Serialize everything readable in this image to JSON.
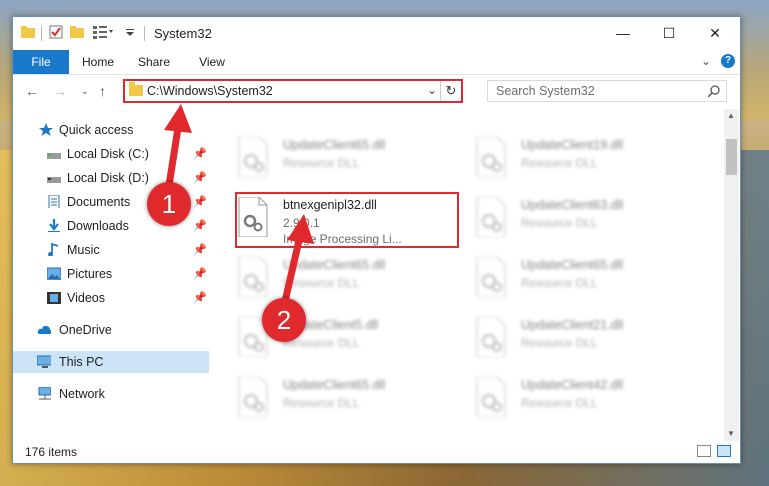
{
  "window": {
    "title": "System32",
    "controls": {
      "minimize": "—",
      "maximize": "☐",
      "close": "✕"
    }
  },
  "ribbon": {
    "tabs": [
      "File",
      "Home",
      "Share",
      "View"
    ],
    "collapse_glyph": "⌄",
    "help_glyph": "?"
  },
  "address": {
    "path": "C:\\Windows\\System32",
    "search_placeholder": "Search System32"
  },
  "nav": {
    "items": [
      {
        "label": "Quick access",
        "icon": "star-icon"
      },
      {
        "label": "Local Disk (C:)",
        "icon": "drive-icon"
      },
      {
        "label": "Local Disk (D:)",
        "icon": "drive-icon"
      },
      {
        "label": "Documents",
        "icon": "documents-icon"
      },
      {
        "label": "Downloads",
        "icon": "download-icon"
      },
      {
        "label": "Music",
        "icon": "music-icon"
      },
      {
        "label": "Pictures",
        "icon": "pictures-icon"
      },
      {
        "label": "Videos",
        "icon": "videos-icon"
      },
      {
        "label": "OneDrive",
        "icon": "cloud-icon"
      },
      {
        "label": "This PC",
        "icon": "computer-icon"
      },
      {
        "label": "Network",
        "icon": "network-icon"
      }
    ]
  },
  "files": [
    {
      "name": "UpdateClient65.dll",
      "line2": "Resource DLL",
      "line3": ""
    },
    {
      "name": "UpdateClient19.dll",
      "line2": "Resource DLL",
      "line3": ""
    },
    {
      "name": "btnexgenipl32.dll",
      "line2": "2.9.0.1",
      "line3": "Image Processing Li..."
    },
    {
      "name": "UpdateClient63.dll",
      "line2": "Resource DLL",
      "line3": ""
    },
    {
      "name": "UpdateClient65.dll",
      "line2": "Resource DLL",
      "line3": ""
    },
    {
      "name": "UpdateClient65.dll",
      "line2": "Resource DLL",
      "line3": ""
    },
    {
      "name": "UpdateClient5.dll",
      "line2": "Resource DLL",
      "line3": ""
    },
    {
      "name": "UpdateClient21.dll",
      "line2": "Resource DLL",
      "line3": ""
    },
    {
      "name": "UpdateClient65.dll",
      "line2": "Resource DLL",
      "line3": ""
    },
    {
      "name": "UpdateClient42.dll",
      "line2": "Resource DLL",
      "line3": ""
    }
  ],
  "status": {
    "item_count": "176 items"
  },
  "annotations": {
    "step1": "1",
    "step2": "2",
    "color": "#e0292c"
  }
}
